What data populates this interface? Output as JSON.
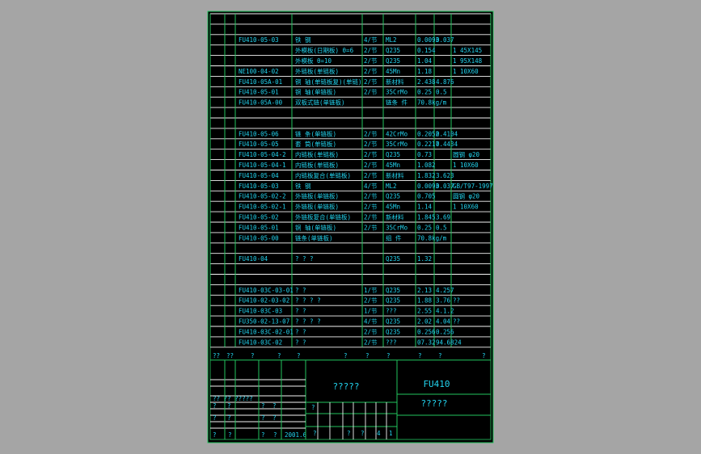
{
  "colors": {
    "background": "#a5a5a5",
    "sheet": "#000000",
    "grid": "#22c55e",
    "text": "#22d3ee",
    "rule": "#f5f5f5"
  },
  "rows": [
    [
      "",
      "",
      "",
      "",
      "",
      "",
      ""
    ],
    [
      "FU410-05-03",
      "铁 钢",
      "4/节",
      "ML2",
      "0.0093",
      "0.037",
      ""
    ],
    [
      "",
      "外模板(日期板)  θ=6",
      "2/节",
      "Q235",
      "0.154",
      "",
      "1 45X145"
    ],
    [
      "",
      "外模板  θ=10",
      "2/节",
      "Q235",
      "1.04",
      "",
      "1 95X148"
    ],
    [
      "NE100-04-02",
      "外链板(单链板)",
      "2/节",
      "45Mn",
      "1.18",
      "",
      "1 10X60"
    ],
    [
      "FU410-05A-01",
      "铜 轴(单链板复)(单链)",
      "2/节",
      "新材料",
      "2.438",
      "4.876",
      ""
    ],
    [
      "FU410-05-01",
      "铜 轴(单链板)",
      "2/节",
      "35CrMo",
      "0.25",
      "0.5",
      ""
    ],
    [
      "FU410-05A-00",
      "双板式链(单链板)",
      "",
      "链条 件",
      "70.8kg/m",
      "",
      ""
    ],
    [
      "",
      "",
      "",
      "",
      "",
      "",
      ""
    ],
    [
      "",
      "",
      "",
      "",
      "",
      "",
      ""
    ],
    [
      "FU410-05-06",
      "链 条(单链板)",
      "2/节",
      "42CrMo",
      "0.2052",
      "0.4104",
      ""
    ],
    [
      "FU410-05-05",
      "套 筒(单链板)",
      "2/节",
      "35CrMo",
      "0.2217",
      "0.4434",
      ""
    ],
    [
      "FU410-05-04-2",
      "内链板(单链板)",
      "2/节",
      "Q235",
      "0.73",
      "",
      "圆钢 φ20"
    ],
    [
      "FU410-05-04-1",
      "内链板(单链板)",
      "2/节",
      "45Mn",
      "1.082",
      "",
      "1 10X60"
    ],
    [
      "FU410-05-04",
      "内链板复合(单链板)",
      "2/节",
      "新材料",
      "1.832",
      "3.623",
      ""
    ],
    [
      "FU410-05-03",
      "铁 钢",
      "4/节",
      "ML2",
      "0.0093",
      "0.037",
      "GB/T97-1997"
    ],
    [
      "FU410-05-02-2",
      "外链板(单链板)",
      "2/节",
      "Q235",
      "0.705",
      "",
      "圆钢 φ20"
    ],
    [
      "FU410-05-02-1",
      "外链板(单链板)",
      "2/节",
      "45Mn",
      "1.14",
      "",
      "1 10X60"
    ],
    [
      "FU410-05-02",
      "外链板复合(单链板)",
      "2/节",
      "新材料",
      "1.845",
      "3.69",
      ""
    ],
    [
      "FU410-05-01",
      "铜 轴(单链板)",
      "2/节",
      "35CrMo",
      "0.25",
      "0.5",
      ""
    ],
    [
      "FU410-05-00",
      "链条(单链板)",
      "",
      "组 件",
      "70.8kg/m",
      "",
      ""
    ],
    [
      "",
      "",
      "",
      "",
      "",
      "",
      ""
    ],
    [
      "FU410-04",
      "? ? ?",
      "",
      "Q235",
      "1.32",
      "",
      ""
    ],
    [
      "",
      "",
      "",
      "",
      "",
      "",
      ""
    ],
    [
      "",
      "",
      "",
      "",
      "",
      "",
      ""
    ],
    [
      "FU410-03C-03-01",
      "?    ?",
      "1/节",
      "Q235",
      "2.13",
      "4.257",
      ""
    ],
    [
      "FU410-02-03-02",
      "? ? ? ?",
      "2/节",
      "Q235",
      "1.88",
      "3.76",
      "??"
    ],
    [
      "FU410-03C-03",
      "?    ?",
      "1/节",
      "???",
      "2.55",
      "4.1.2",
      ""
    ],
    [
      "FU350-02-13-07",
      "? ? ? ?",
      "4/节",
      "Q235",
      "2.02",
      "4.04",
      "??"
    ],
    [
      "FU410-03C-02-01",
      "?    ?",
      "2/节",
      "Q235",
      "0.256",
      "0.256",
      ""
    ],
    [
      "FU410-03C-02",
      "?    ?",
      "2/节",
      "???",
      "07.32",
      "94.6824",
      ""
    ]
  ],
  "header_labels": [
    "??",
    "??",
    "?",
    "?",
    "?",
    "?",
    "?",
    "?",
    "?",
    "?",
    "?"
  ],
  "title_block": {
    "drawing_code": "FU410",
    "title_top": "?????",
    "title_bottom": "?????",
    "designer_row": "?? ??  ?????",
    "date": "2001.6",
    "sign_labels": [
      "?",
      "?",
      "?",
      "?",
      "?",
      "?",
      "?",
      "?",
      "?",
      "?",
      "?",
      "?",
      "?"
    ],
    "bottom_cells": [
      "?",
      "?",
      "?",
      "4",
      "1"
    ]
  }
}
